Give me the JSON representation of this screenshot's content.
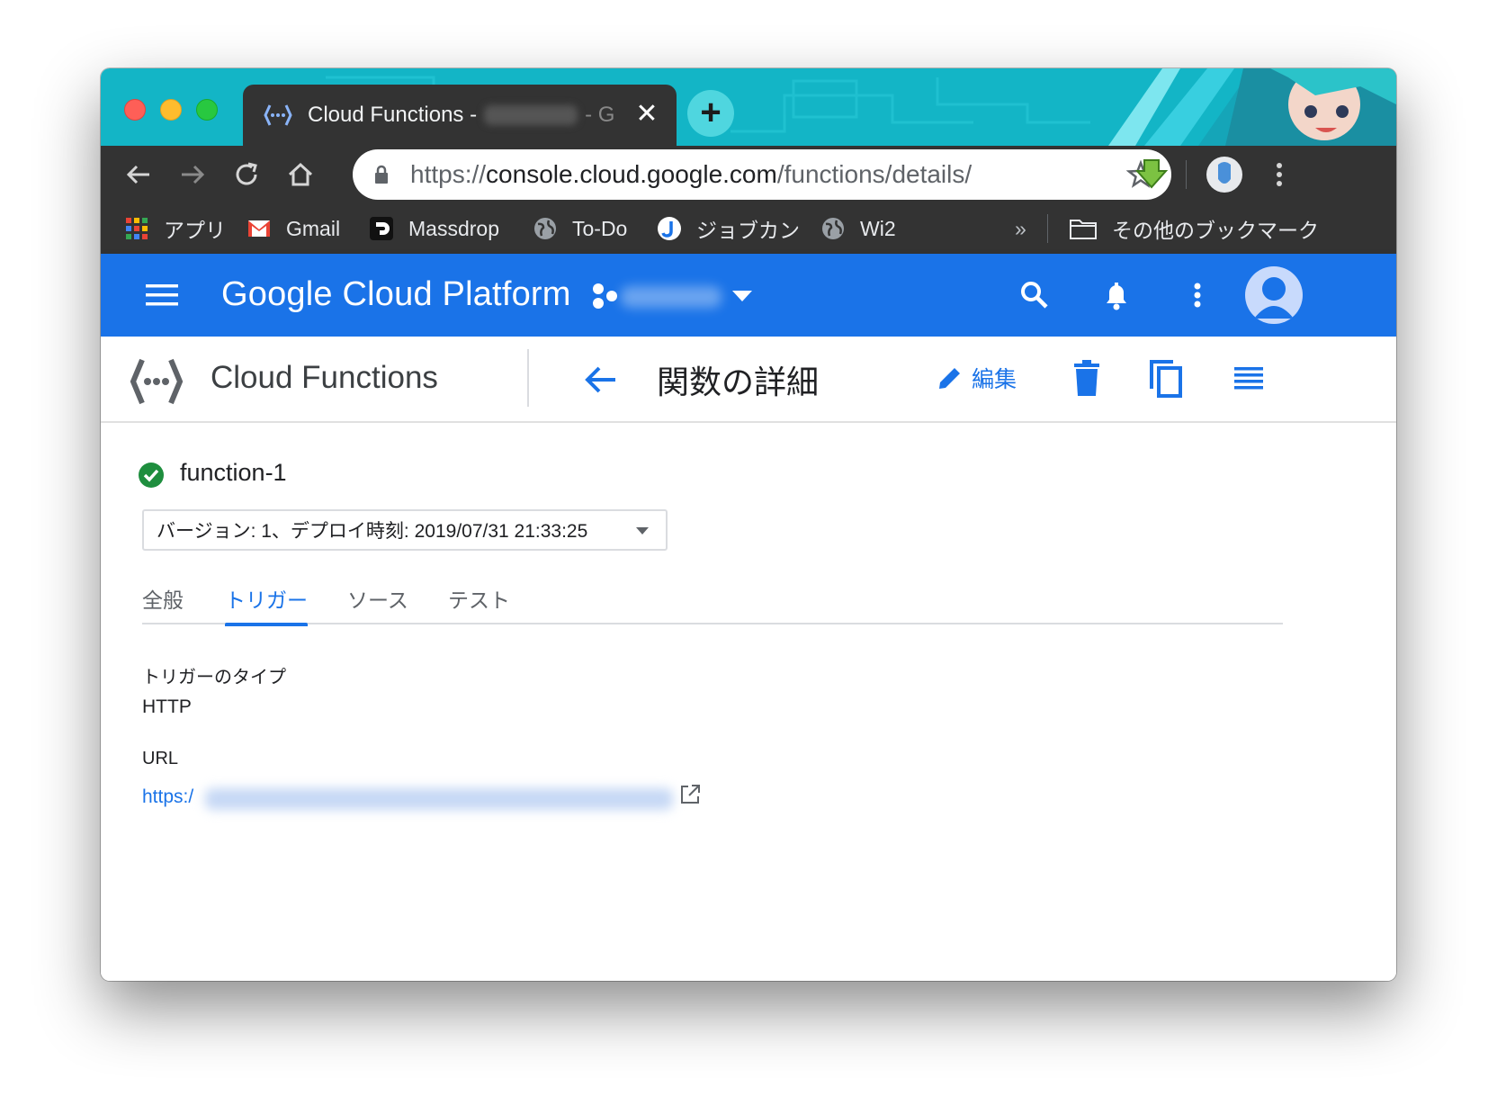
{
  "browser": {
    "tab": {
      "title_prefix": "Cloud Functions -",
      "title_suffix": "- G",
      "close_glyph": "✕"
    },
    "new_tab_glyph": "+",
    "url": {
      "scheme": "https://",
      "host": "console.cloud.google.com",
      "path": "/functions/details/"
    },
    "bookmarks": [
      {
        "label": "アプリ",
        "icon": "apps-grid-icon"
      },
      {
        "label": "Gmail",
        "icon": "gmail-icon"
      },
      {
        "label": "Massdrop",
        "icon": "massdrop-icon"
      },
      {
        "label": "To-Do",
        "icon": "globe-icon"
      },
      {
        "label": "ジョブカン",
        "icon": "jobcan-icon"
      },
      {
        "label": "Wi2",
        "icon": "globe-icon"
      }
    ],
    "bookmarks_overflow": "»",
    "other_bookmarks": "その他のブックマーク"
  },
  "gcp": {
    "brand": "Google Cloud Platform",
    "accent": "#1a73e8"
  },
  "subheader": {
    "product": "Cloud Functions",
    "page_title": "関数の詳細",
    "edit_label": "編集"
  },
  "function": {
    "name": "function-1",
    "status_color": "#1e8e3e",
    "version_text": "バージョン: 1、デプロイ時刻: 2019/07/31 21:33:25",
    "tabs": [
      "全般",
      "トリガー",
      "ソース",
      "テスト"
    ],
    "active_tab": "トリガー",
    "trigger_type_label": "トリガーのタイプ",
    "trigger_type_value": "HTTP",
    "url_label": "URL",
    "url_value": "https:/"
  }
}
